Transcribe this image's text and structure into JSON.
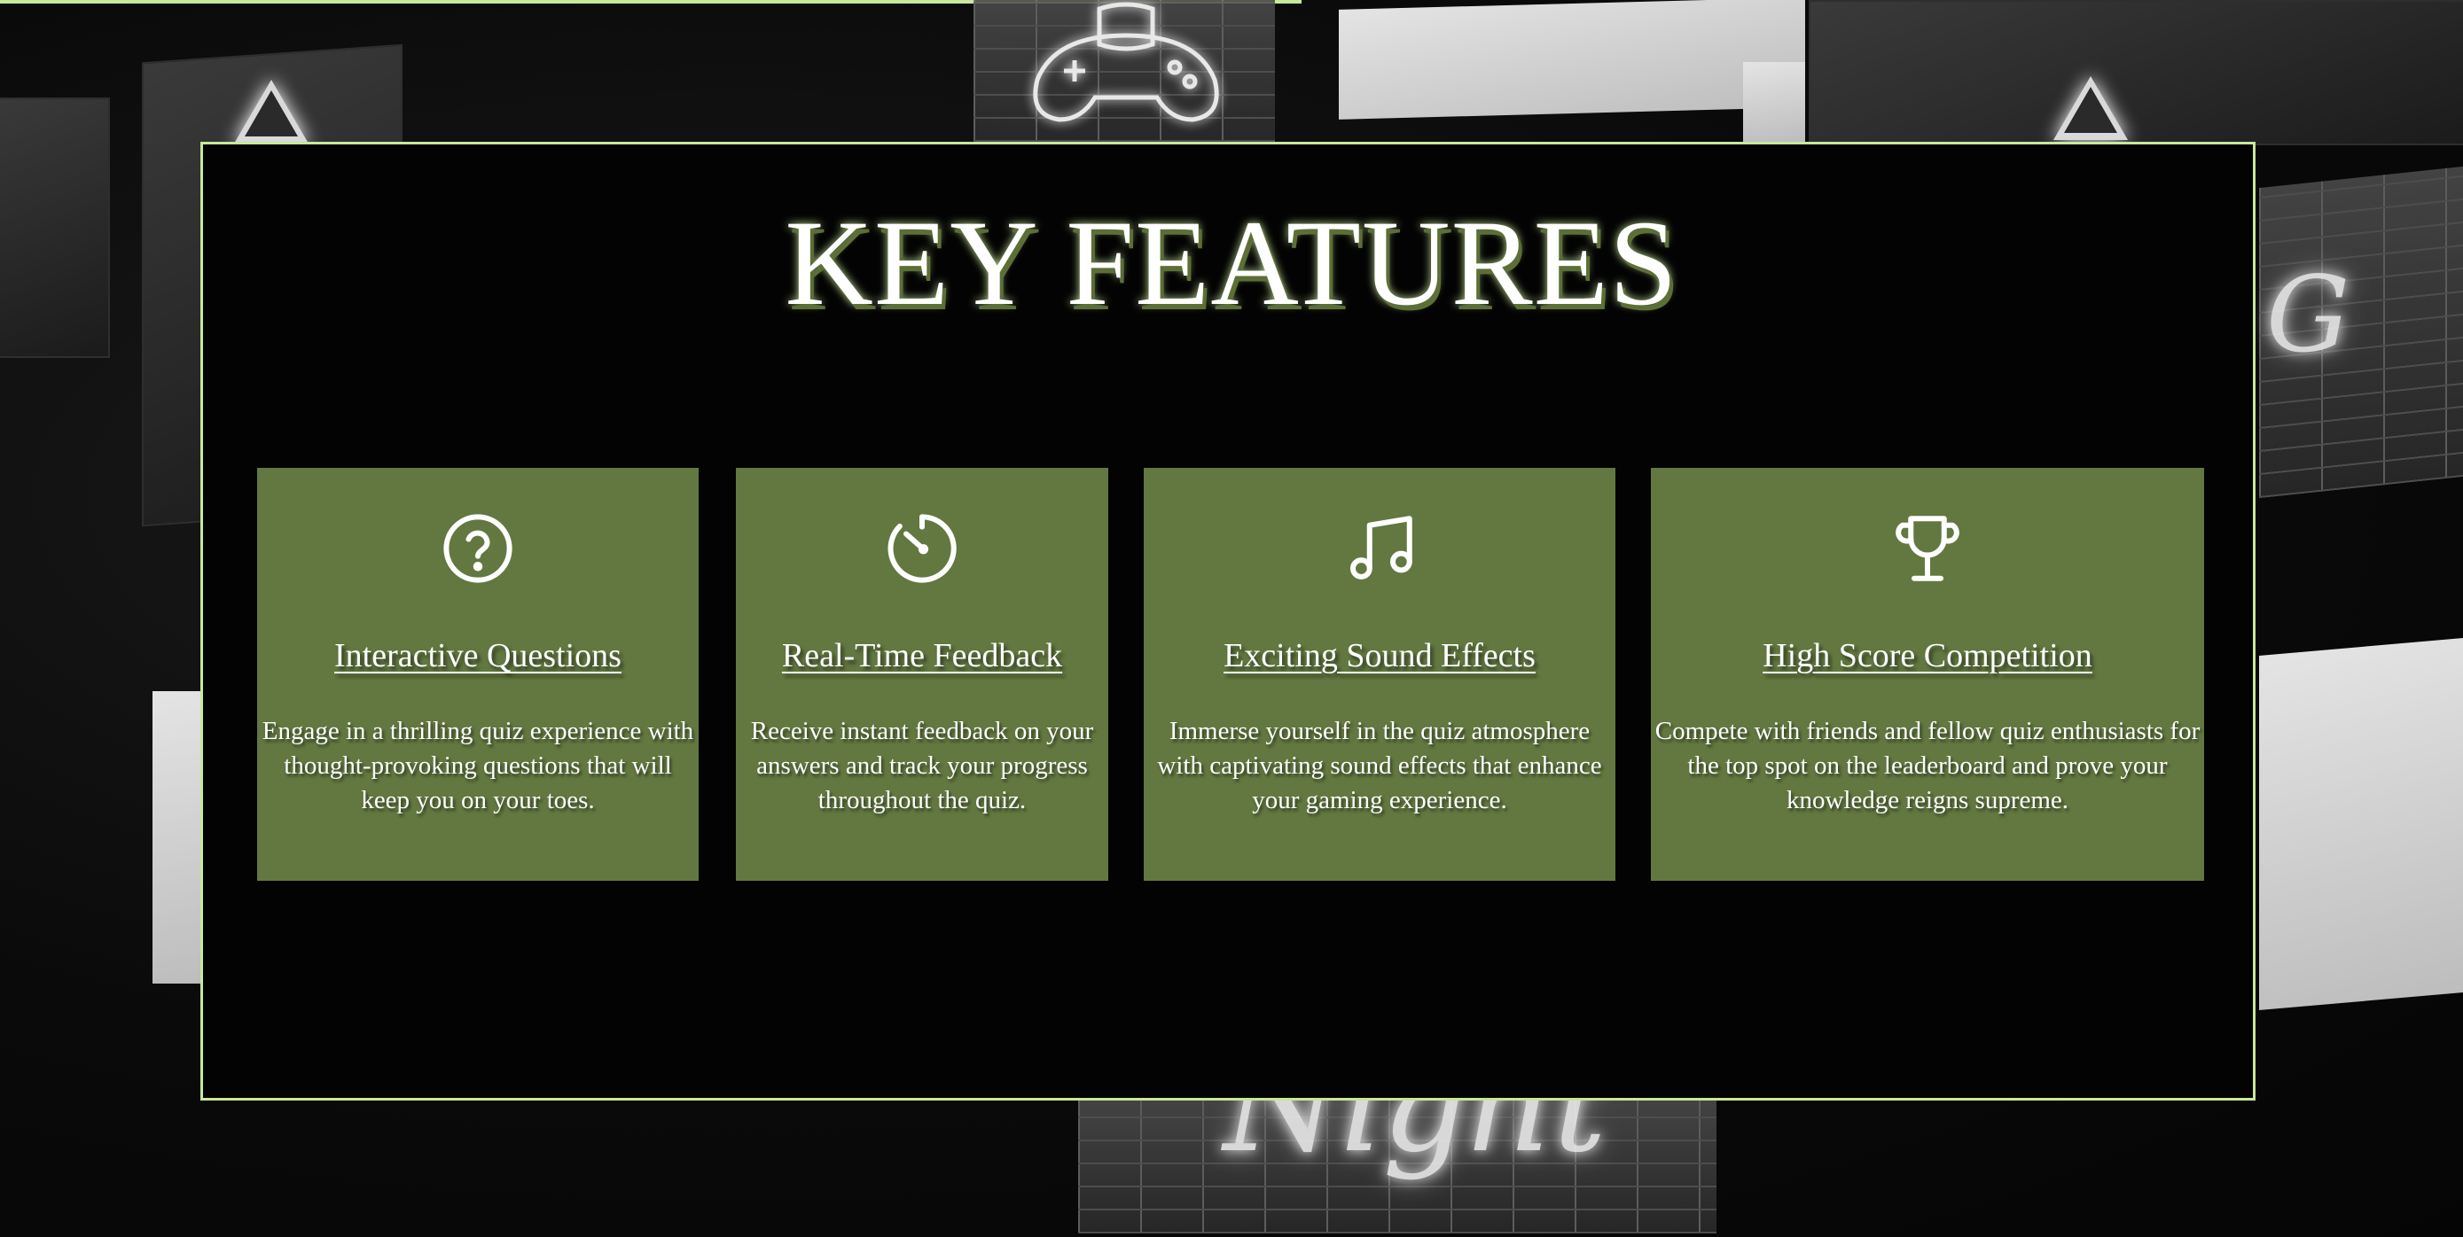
{
  "section": {
    "title": "KEY FEATURES"
  },
  "colors": {
    "card_background": "#627840",
    "box_border": "#c8e89a",
    "box_background": "#030303",
    "text": "#ffffff"
  },
  "features": [
    {
      "icon": "question-circle-icon",
      "title": "Interactive Questions",
      "description": "Engage in a thrilling quiz experience with thought-provoking questions that will keep you on your toes."
    },
    {
      "icon": "stopwatch-icon",
      "title": "Real-Time Feedback",
      "description": "Receive instant feedback on your answers and track your progress throughout the quiz."
    },
    {
      "icon": "music-note-icon",
      "title": "Exciting Sound Effects",
      "description": "Immerse yourself in the quiz atmosphere with captivating sound effects that enhance your gaming experience."
    },
    {
      "icon": "trophy-icon",
      "title": "High Score Competition",
      "description": "Compete with friends and fellow quiz enthusiasts for the top spot on the leaderboard and prove your knowledge reigns supreme."
    }
  ]
}
